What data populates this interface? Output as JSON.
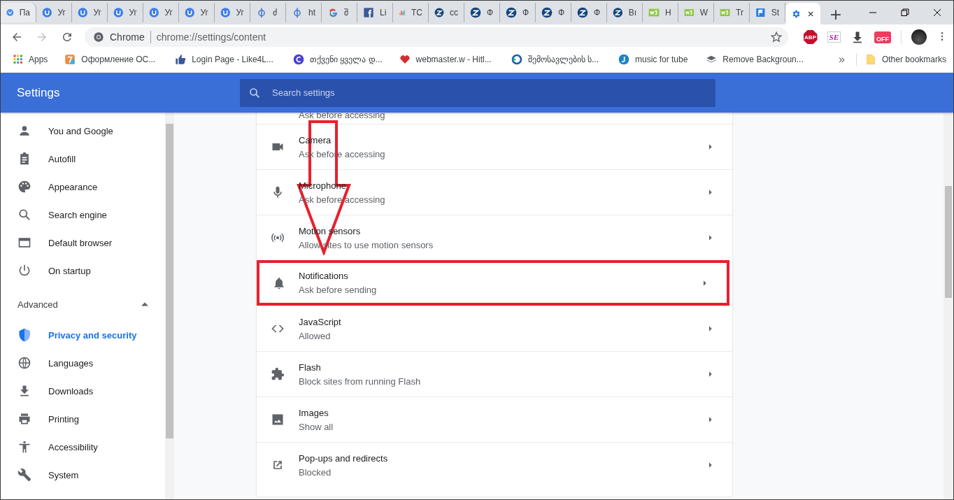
{
  "tabs": [
    {
      "kind": "v",
      "title": "Па",
      "selected": false
    },
    {
      "kind": "u",
      "title": "Уг",
      "selected": false
    },
    {
      "kind": "u",
      "title": "Уг",
      "selected": false
    },
    {
      "kind": "u",
      "title": "Уг",
      "selected": false
    },
    {
      "kind": "u",
      "title": "Уг",
      "selected": false
    },
    {
      "kind": "u",
      "title": "Уг",
      "selected": false
    },
    {
      "kind": "u",
      "title": "Уг",
      "selected": false
    },
    {
      "kind": "phi",
      "title": "ძ",
      "selected": false
    },
    {
      "kind": "phi",
      "title": "ht",
      "selected": false
    },
    {
      "kind": "g",
      "title": "შ",
      "selected": false
    },
    {
      "kind": "fb",
      "title": "Li",
      "selected": false
    },
    {
      "kind": "chart",
      "title": "TC",
      "selected": false
    },
    {
      "kind": "z",
      "title": "cc",
      "selected": false
    },
    {
      "kind": "z",
      "title": "Ф",
      "selected": false
    },
    {
      "kind": "z",
      "title": "Ф",
      "selected": false
    },
    {
      "kind": "z",
      "title": "Ф",
      "selected": false
    },
    {
      "kind": "z",
      "title": "Ф",
      "selected": false
    },
    {
      "kind": "z",
      "title": "Bı",
      "selected": false
    },
    {
      "kind": "w3",
      "title": "H",
      "selected": false
    },
    {
      "kind": "w3",
      "title": "W",
      "selected": false
    },
    {
      "kind": "w3",
      "title": "Tr",
      "selected": false
    },
    {
      "kind": "flag",
      "title": "St",
      "selected": false
    },
    {
      "kind": "gear",
      "selected": true
    }
  ],
  "new_tab": "+",
  "nav": [
    {
      "kind": "back",
      "disabled": false
    },
    {
      "kind": "forward",
      "disabled": true
    },
    {
      "kind": "reload",
      "disabled": false
    }
  ],
  "omnibox": {
    "chip": "Chrome",
    "url": "chrome://settings/content"
  },
  "extensions": [
    {
      "kind": "abp",
      "label": "ABP"
    },
    {
      "kind": "se",
      "label": "SE"
    },
    {
      "kind": "download"
    },
    {
      "kind": "off",
      "label": "OFF"
    }
  ],
  "bookmarks": [
    {
      "kind": "apps",
      "title": "Apps"
    },
    {
      "kind": "seven",
      "title": "Оформление ОС..."
    },
    {
      "kind": "like",
      "title": "Login Page - Like4L..."
    },
    {
      "kind": "c",
      "title": "თქვენი ყველა დ..."
    },
    {
      "kind": "heart",
      "title": "webmaster.w - Hitl..."
    },
    {
      "kind": "rs",
      "title": "შემოსავლების ს..."
    },
    {
      "kind": "j",
      "title": "music for tube"
    },
    {
      "kind": "layers",
      "title": "Remove Backgroun..."
    }
  ],
  "more_bookmarks": "»",
  "other_bookmarks": "Other bookmarks",
  "header": {
    "title": "Settings",
    "search_placeholder": "Search settings"
  },
  "sidebar": {
    "items": [
      {
        "kind": "person",
        "label": "You and Google",
        "selected": false
      },
      {
        "kind": "clipboard",
        "label": "Autofill",
        "selected": false
      },
      {
        "kind": "palette",
        "label": "Appearance",
        "selected": false
      },
      {
        "kind": "search",
        "label": "Search engine",
        "selected": false
      },
      {
        "kind": "browser",
        "label": "Default browser",
        "selected": false
      },
      {
        "kind": "power",
        "label": "On startup",
        "selected": false
      }
    ],
    "advanced": {
      "label": "Advanced",
      "expanded": true
    },
    "advanced_items": [
      {
        "kind": "shield",
        "label": "Privacy and security",
        "selected": true
      },
      {
        "kind": "globe",
        "label": "Languages",
        "selected": false
      },
      {
        "kind": "download",
        "label": "Downloads",
        "selected": false
      },
      {
        "kind": "print",
        "label": "Printing",
        "selected": false
      },
      {
        "kind": "access",
        "label": "Accessibility",
        "selected": false
      },
      {
        "kind": "wrench",
        "label": "System",
        "selected": false
      }
    ]
  },
  "content": {
    "top_partial": "Ask before accessing",
    "rows": [
      {
        "kind": "camera",
        "title": "Camera",
        "subtitle": "Ask before accessing",
        "highlighted": false
      },
      {
        "kind": "mic",
        "title": "Microphone",
        "subtitle": "Ask before accessing",
        "highlighted": false
      },
      {
        "kind": "sensor",
        "title": "Motion sensors",
        "subtitle": "Allow sites to use motion sensors",
        "highlighted": false
      },
      {
        "kind": "bell",
        "title": "Notifications",
        "subtitle": "Ask before sending",
        "highlighted": true
      },
      {
        "kind": "code",
        "title": "JavaScript",
        "subtitle": "Allowed",
        "highlighted": false
      },
      {
        "kind": "puzzle",
        "title": "Flash",
        "subtitle": "Block sites from running Flash",
        "highlighted": false
      },
      {
        "kind": "image",
        "title": "Images",
        "subtitle": "Show all",
        "highlighted": false
      },
      {
        "kind": "popup",
        "title": "Pop-ups and redirects",
        "subtitle": "Blocked",
        "highlighted": false
      }
    ]
  }
}
